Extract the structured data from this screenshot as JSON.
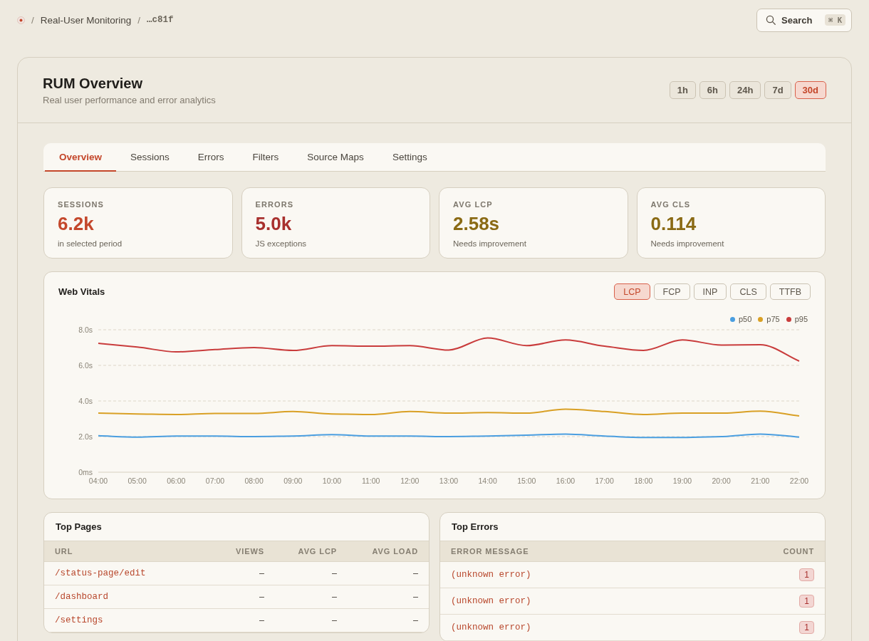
{
  "breadcrumb": {
    "items": [
      {
        "separator": "/",
        "label": "Real-User Monitoring",
        "kind": "link"
      },
      {
        "separator": "/",
        "label": "…c81f",
        "kind": "mono"
      }
    ]
  },
  "search": {
    "label": "Search",
    "shortcut": "⌘ K"
  },
  "header": {
    "title": "RUM Overview",
    "subtitle": "Real user performance and error analytics",
    "ranges": [
      {
        "label": "1h",
        "selected": false
      },
      {
        "label": "6h",
        "selected": false
      },
      {
        "label": "24h",
        "selected": false
      },
      {
        "label": "7d",
        "selected": false
      },
      {
        "label": "30d",
        "selected": true
      }
    ]
  },
  "tabs": [
    {
      "label": "Overview",
      "selected": true
    },
    {
      "label": "Sessions",
      "selected": false
    },
    {
      "label": "Errors",
      "selected": false
    },
    {
      "label": "Filters",
      "selected": false
    },
    {
      "label": "Source Maps",
      "selected": false
    },
    {
      "label": "Settings",
      "selected": false
    }
  ],
  "stats": [
    {
      "label": "SESSIONS",
      "value": "6.2k",
      "caption": "in selected period",
      "color": "#c4472b"
    },
    {
      "label": "ERRORS",
      "value": "5.0k",
      "caption": "JS exceptions",
      "color": "#a8302e"
    },
    {
      "label": "AVG LCP",
      "value": "2.58s",
      "caption": "Needs improvement",
      "color": "#8a6a14"
    },
    {
      "label": "AVG CLS",
      "value": "0.114",
      "caption": "Needs improvement",
      "color": "#8a6a14"
    }
  ],
  "web_vitals": {
    "title": "Web Vitals",
    "metrics": [
      {
        "label": "LCP",
        "selected": true
      },
      {
        "label": "FCP",
        "selected": false
      },
      {
        "label": "INP",
        "selected": false
      },
      {
        "label": "CLS",
        "selected": false
      },
      {
        "label": "TTFB",
        "selected": false
      }
    ],
    "chart_data": {
      "type": "line",
      "grid": true,
      "x": [
        "04:00",
        "05:00",
        "06:00",
        "07:00",
        "08:00",
        "09:00",
        "10:00",
        "11:00",
        "12:00",
        "13:00",
        "14:00",
        "15:00",
        "16:00",
        "17:00",
        "18:00",
        "19:00",
        "20:00",
        "21:00",
        "22:00"
      ],
      "ylim": [
        0,
        8
      ],
      "yticks": [
        {
          "value": 0,
          "label": "0ms"
        },
        {
          "value": 2,
          "label": "2.0s"
        },
        {
          "value": 4,
          "label": "4.0s"
        },
        {
          "value": 6,
          "label": "6.0s"
        },
        {
          "value": 8,
          "label": "8.0s"
        }
      ],
      "series": [
        {
          "name": "p50",
          "color": "#4a9ee0",
          "values": [
            2.05,
            1.97,
            2.03,
            2.03,
            2.0,
            2.03,
            2.11,
            2.03,
            2.03,
            2.0,
            2.03,
            2.08,
            2.14,
            2.03,
            1.95,
            1.95,
            2.0,
            2.14,
            1.97
          ]
        },
        {
          "name": "p75",
          "color": "#d9a025",
          "values": [
            3.32,
            3.27,
            3.24,
            3.3,
            3.3,
            3.41,
            3.27,
            3.24,
            3.41,
            3.32,
            3.35,
            3.32,
            3.54,
            3.41,
            3.24,
            3.32,
            3.32,
            3.43,
            3.16
          ]
        },
        {
          "name": "p95",
          "color": "#c93c3c",
          "values": [
            7.24,
            7.03,
            6.76,
            6.89,
            7.0,
            6.84,
            7.11,
            7.08,
            7.11,
            6.86,
            7.54,
            7.11,
            7.43,
            7.08,
            6.84,
            7.43,
            7.14,
            7.16,
            6.24
          ]
        }
      ]
    }
  },
  "top_pages": {
    "title": "Top Pages",
    "columns": [
      "URL",
      "VIEWS",
      "AVG LCP",
      "AVG LOAD"
    ],
    "rows": [
      [
        "/status-page/edit",
        "–",
        "–",
        "–"
      ],
      [
        "/dashboard",
        "–",
        "–",
        "–"
      ],
      [
        "/settings",
        "–",
        "–",
        "–"
      ]
    ]
  },
  "top_errors": {
    "title": "Top Errors",
    "columns": [
      "ERROR MESSAGE",
      "COUNT"
    ],
    "rows": [
      {
        "message": "(unknown error)",
        "count": "1"
      },
      {
        "message": "(unknown error)",
        "count": "1"
      },
      {
        "message": "(unknown error)",
        "count": "1"
      }
    ]
  }
}
